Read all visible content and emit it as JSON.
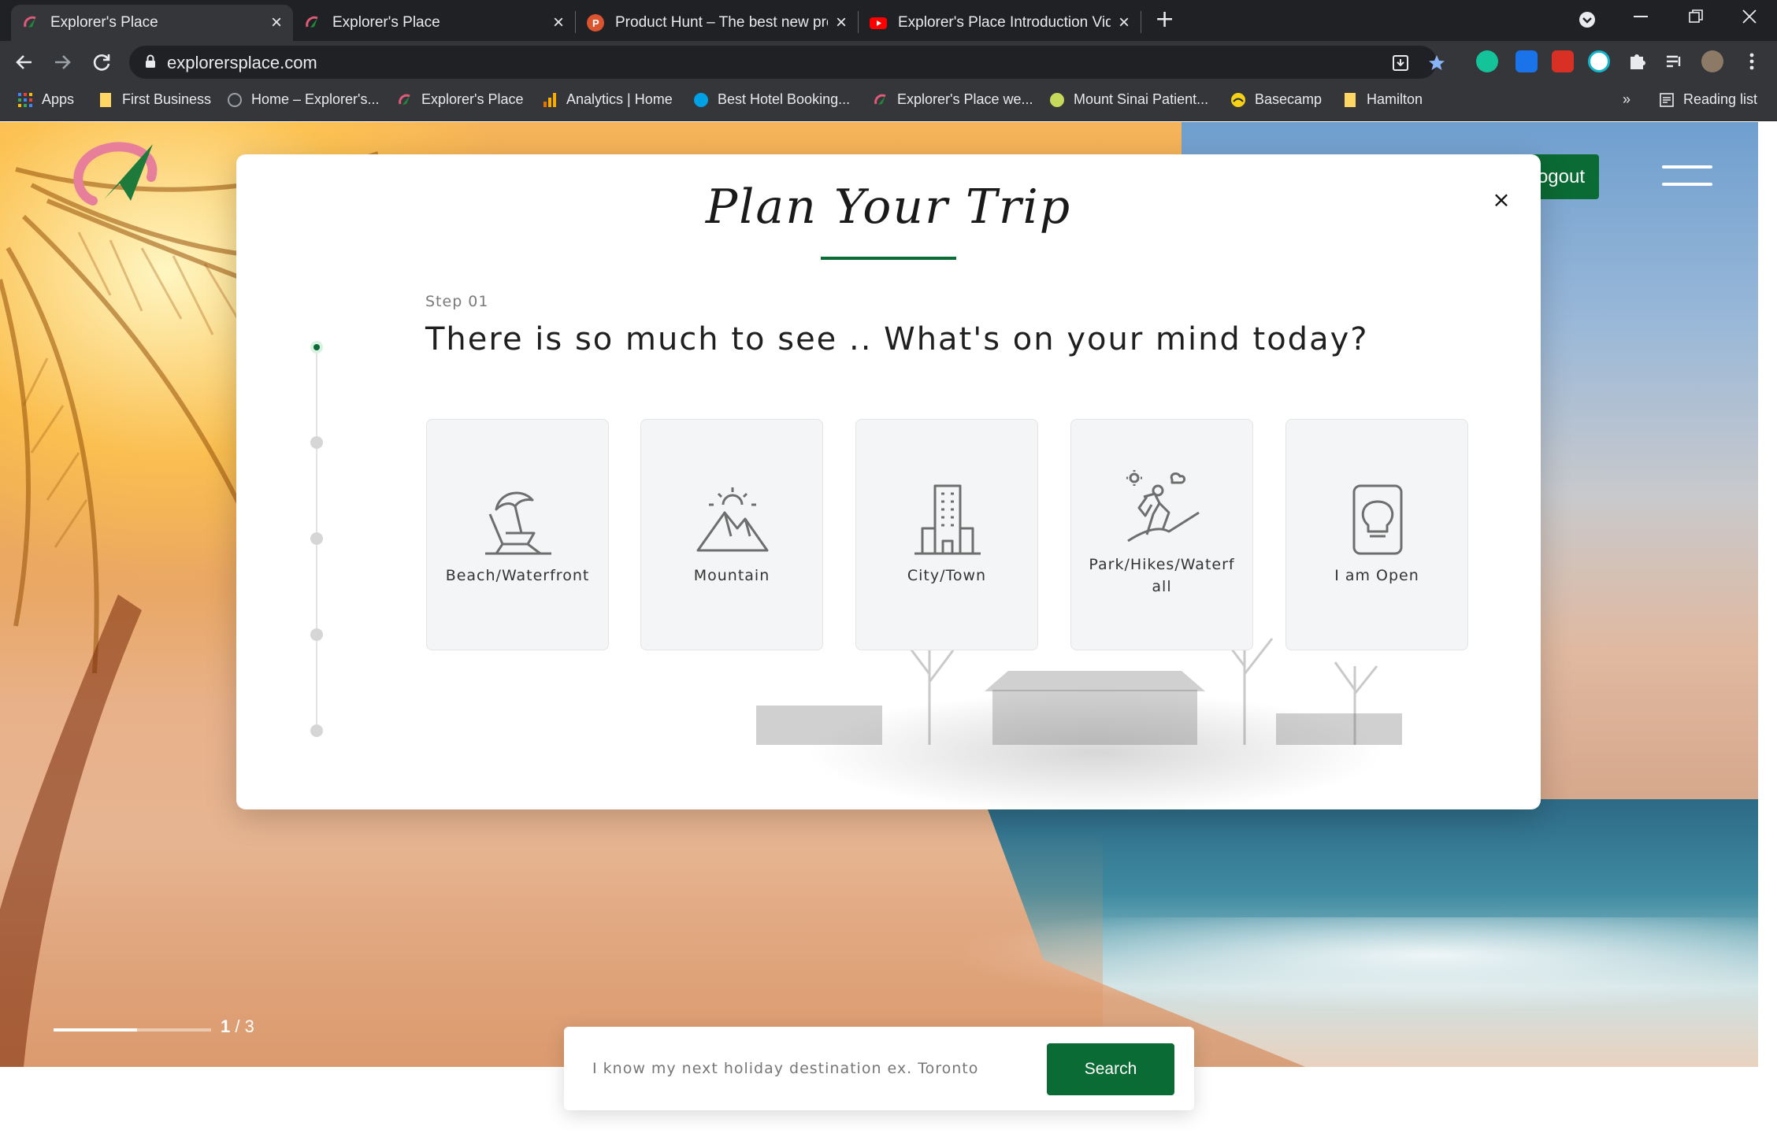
{
  "browser": {
    "tabs": [
      {
        "title": "Explorer's Place",
        "active": true,
        "icon": "explorers-place-icon"
      },
      {
        "title": "Explorer's Place",
        "active": false,
        "icon": "explorers-place-icon"
      },
      {
        "title": "Product Hunt – The best new pro",
        "active": false,
        "icon": "product-hunt-icon"
      },
      {
        "title": "Explorer's Place Introduction Vide",
        "active": false,
        "icon": "youtube-icon"
      }
    ],
    "close_glyph": "×",
    "newtab_glyph": "+",
    "url": "explorersplace.com",
    "bookmarks": [
      {
        "label": "Apps",
        "icon": "apps-grid-icon"
      },
      {
        "label": "First Business",
        "icon": "folder-icon"
      },
      {
        "label": "Home – Explorer's...",
        "icon": "globe-icon"
      },
      {
        "label": "Explorer's Place",
        "icon": "explorers-place-icon"
      },
      {
        "label": "Analytics | Home",
        "icon": "analytics-icon"
      },
      {
        "label": "Best Hotel Booking...",
        "icon": "hotel-icon"
      },
      {
        "label": "Explorer's Place we...",
        "icon": "explorers-place-icon"
      },
      {
        "label": "Mount Sinai Patient...",
        "icon": "mount-sinai-icon"
      },
      {
        "label": "Basecamp",
        "icon": "basecamp-icon"
      },
      {
        "label": "Hamilton",
        "icon": "folder-icon"
      }
    ],
    "overflow_glyph": "»",
    "reading_list": "Reading list",
    "colors": {
      "chrome_dark": "#202124",
      "chrome": "#35363a",
      "text": "#e8eaed"
    }
  },
  "page": {
    "logout_label": "Logout",
    "slider": {
      "current": "1",
      "total": "3",
      "separator": "/",
      "progress_fraction": 0.53
    },
    "search": {
      "placeholder": "I know my next holiday destination ex. Toronto",
      "button_label": "Search"
    },
    "accent_color": "#0b6b34"
  },
  "modal": {
    "title": "Plan Your Trip",
    "close_glyph": "×",
    "step_label": "Step 01",
    "question": "There is so much to see .. What's on your mind today?",
    "steps": [
      {
        "active": true
      },
      {
        "active": false
      },
      {
        "active": false
      },
      {
        "active": false
      },
      {
        "active": false
      }
    ],
    "options": [
      {
        "label": "Beach/Waterfront",
        "icon": "beach-umbrella-icon"
      },
      {
        "label": "Mountain",
        "icon": "mountain-sun-icon"
      },
      {
        "label": "City/Town",
        "icon": "building-icon"
      },
      {
        "label": "Park/Hikes/Waterfall",
        "icon": "hiker-icon"
      },
      {
        "label": "I am Open",
        "icon": "lightbulb-icon"
      }
    ]
  }
}
